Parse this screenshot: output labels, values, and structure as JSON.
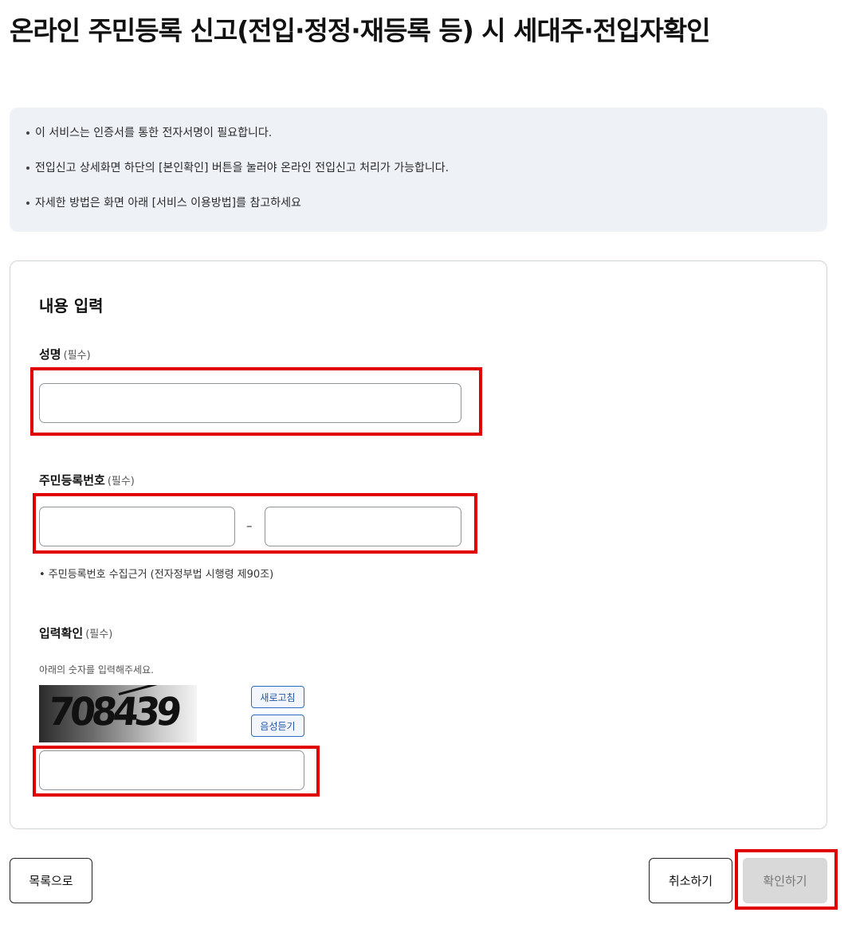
{
  "page": {
    "title": "온라인 주민등록 신고(전입·정정·재등록 등) 시 세대주·전입자확인"
  },
  "notice": {
    "items": [
      "이 서비스는 인증서를 통한 전자서명이 필요합니다.",
      "전입신고 상세화면 하단의 [본인확인] 버튼을 눌러야 온라인 전입신고 처리가 가능합니다.",
      "자세한 방법은 화면 아래 [서비스 이용방법]를 참고하세요"
    ]
  },
  "form": {
    "section_title": "내용 입력",
    "required_label": "(필수)",
    "name": {
      "label": "성명",
      "value": ""
    },
    "rrn": {
      "label": "주민등록번호",
      "first_value": "",
      "second_value": "",
      "separator": "–",
      "hint": "• 주민등록번호 수집근거 (전자정부법 시행령 제90조)"
    },
    "captcha": {
      "label": "입력확인",
      "instruction": "아래의 숫자를 입력해주세요.",
      "code": "708439",
      "refresh_label": "새로고침",
      "audio_label": "음성듣기",
      "value": ""
    }
  },
  "buttons": {
    "list_label": "목록으로",
    "cancel_label": "취소하기",
    "confirm_label": "확인하기"
  },
  "colors": {
    "highlight": "#e10000",
    "notice_bg": "#eef1f6",
    "accent_blue": "#2d6bc2",
    "disabled_bg": "#d9d9d9"
  }
}
